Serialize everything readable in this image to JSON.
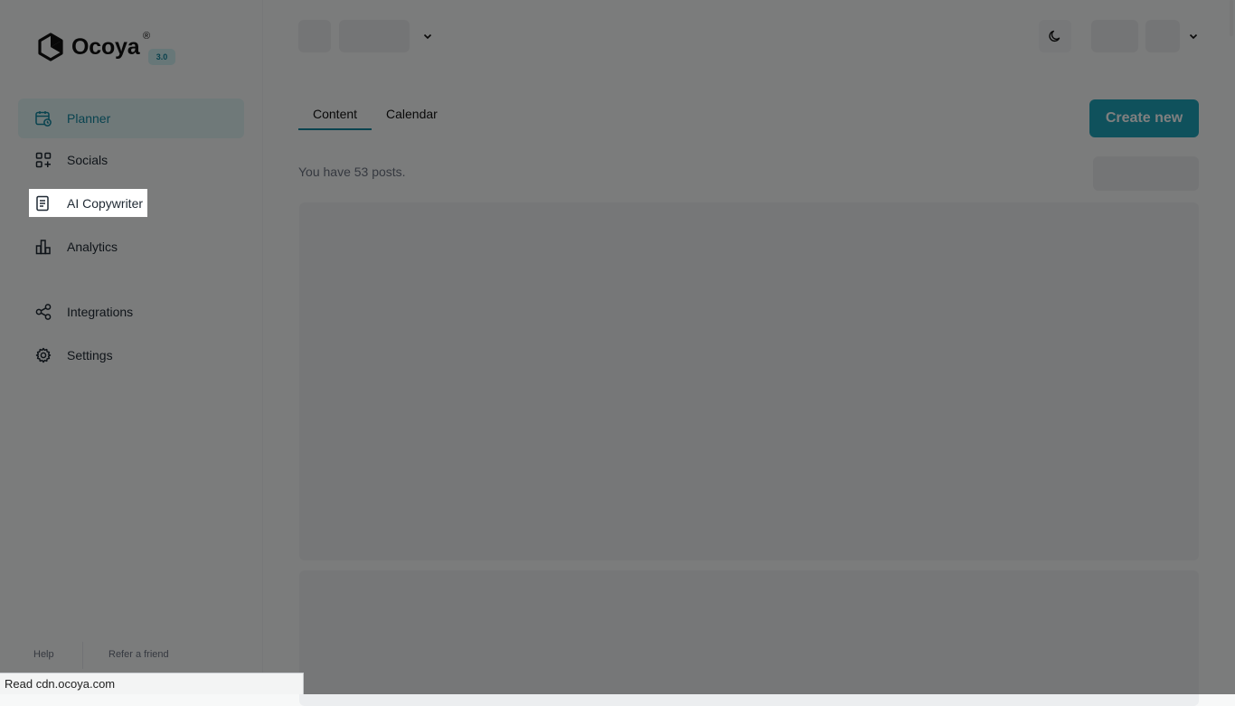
{
  "app": {
    "logo_text": "Ocoya",
    "logo_mark": "®",
    "version": "3.0"
  },
  "sidebar": {
    "items": [
      {
        "label": "Planner",
        "icon": "calendar-clock-icon"
      },
      {
        "label": "Socials",
        "icon": "apps-add-icon"
      },
      {
        "label": "AI Copywriter",
        "icon": "document-icon"
      },
      {
        "label": "Analytics",
        "icon": "bar-chart-icon"
      },
      {
        "label": "Integrations",
        "icon": "share-nodes-icon"
      },
      {
        "label": "Settings",
        "icon": "gear-icon"
      }
    ],
    "footer": {
      "help": "Help",
      "refer": "Refer a friend"
    }
  },
  "main": {
    "tabs": [
      {
        "label": "Content"
      },
      {
        "label": "Calendar"
      }
    ],
    "create_label": "Create new",
    "posts_count_text": "You have 53 posts."
  },
  "statusbar": {
    "text": "Read cdn.ocoya.com"
  },
  "colors": {
    "accent": "#13879f",
    "button": "#1fa2b9",
    "active_bg": "#dff2f3"
  }
}
